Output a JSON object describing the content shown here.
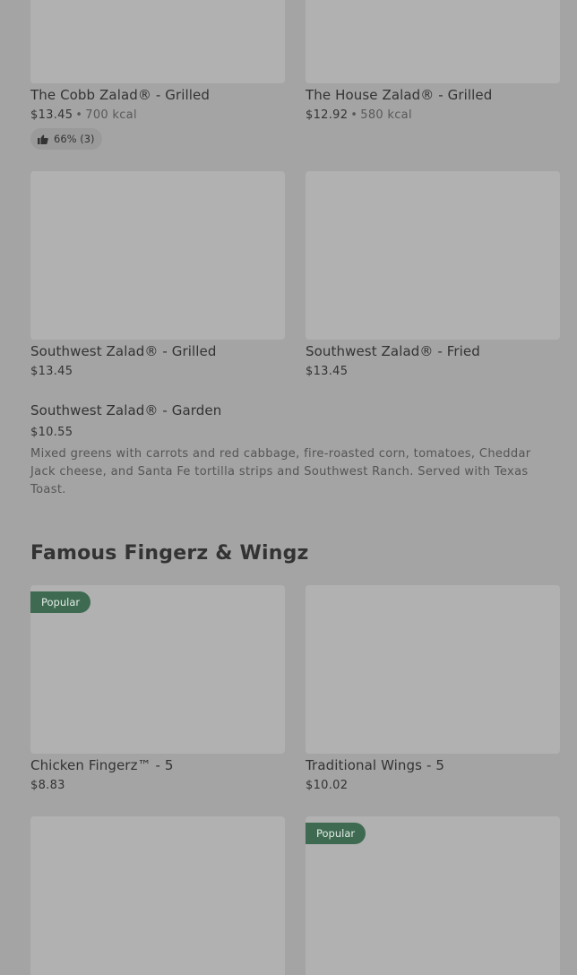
{
  "salads": [
    {
      "name": "The Cobb Zalad® - Grilled",
      "price": "$13.45",
      "kcal": "700 kcal",
      "rating": "66% (3)"
    },
    {
      "name": "The House Zalad® - Grilled",
      "price": "$12.92",
      "kcal": "580 kcal"
    },
    {
      "name": "Southwest Zalad® - Grilled",
      "price": "$13.45"
    },
    {
      "name": "Southwest Zalad® - Fried",
      "price": "$13.45"
    },
    {
      "name": "Southwest Zalad® - Garden",
      "price": "$10.55",
      "description": "Mixed greens with carrots and red cabbage, fire-roasted corn, tomatoes, Cheddar Jack cheese, and Santa Fe tortilla strips and Southwest Ranch. Served with Texas Toast."
    }
  ],
  "separator": "•",
  "section": {
    "title": "Famous Fingerz & Wingz"
  },
  "wings": [
    {
      "name": "Chicken Fingerz™ - 5",
      "price": "$8.83",
      "badge": "Popular"
    },
    {
      "name": "Traditional Wings - 5",
      "price": "$10.02"
    },
    {
      "badge": "Popular"
    }
  ],
  "colors": {
    "background": "#a4a4a4",
    "badge": "#3d6a50",
    "thumbnail": "#b1b1b1"
  }
}
